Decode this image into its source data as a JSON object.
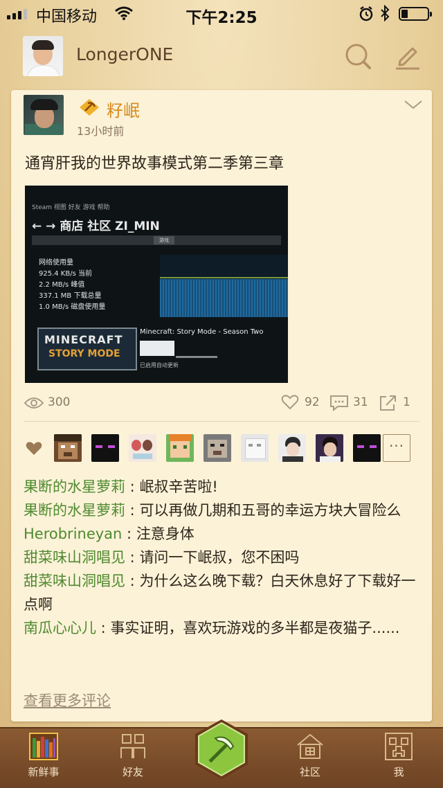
{
  "status_bar": {
    "carrier": "中国移动",
    "time": "下午2:25"
  },
  "header": {
    "username": "LongerONE",
    "search_icon": "search-icon",
    "edit_icon": "pencil-icon"
  },
  "post": {
    "author": "籽岷",
    "time": "13小时前",
    "text": "通宵肝我的世界故事模式第二季第三章",
    "photo": {
      "menu": "Steam 视图 好友 游戏 帮助",
      "nav": "← → 商店 社区 ZI_MIN",
      "search_tag": "游戏",
      "stats": [
        "网络使用量",
        "925.4 KB/s 当前",
        "2.2 MB/s 峰值",
        "337.1 MB 下载总量",
        "1.0 MB/s 磁盘使用量"
      ],
      "game_logo_top": "MINECRAFT",
      "game_logo_bottom": "STORY MODE",
      "game_title": "Minecraft: Story Mode - Season Two",
      "download_status": "已启用自动更新"
    },
    "views": "300",
    "likes": "92",
    "comments": "31",
    "shares": "1",
    "liker_count_visible": 9,
    "more_likers_label": "···"
  },
  "comments": [
    {
      "author": "果断的水星萝莉",
      "text": "岷叔辛苦啦!"
    },
    {
      "author": "果断的水星萝莉",
      "text": "可以再做几期和五哥的幸运方块大冒险么"
    },
    {
      "author": "Herobrineyan",
      "text": "注意身体"
    },
    {
      "author": "甜菜味山洞唱见",
      "text": "请问一下岷叔，您不困吗"
    },
    {
      "author": "甜菜味山洞唱见",
      "text": "为什么这么晚下载？白天休息好了下载好一点啊"
    },
    {
      "author": "南瓜心心儿",
      "text": "事实证明，喜欢玩游戏的多半都是夜猫子......"
    }
  ],
  "view_more": "查看更多评论",
  "tabs": [
    {
      "label": "新鲜事",
      "icon": "bookshelf-icon"
    },
    {
      "label": "好友",
      "icon": "friends-icon"
    },
    {
      "label": "",
      "icon": "pickaxe-icon"
    },
    {
      "label": "社区",
      "icon": "house-icon"
    },
    {
      "label": "我",
      "icon": "creeper-icon"
    }
  ],
  "colors": {
    "accent_green": "#4f8a2f",
    "author_orange": "#d88a1e",
    "tabbar_brown": "#7a4c29"
  }
}
